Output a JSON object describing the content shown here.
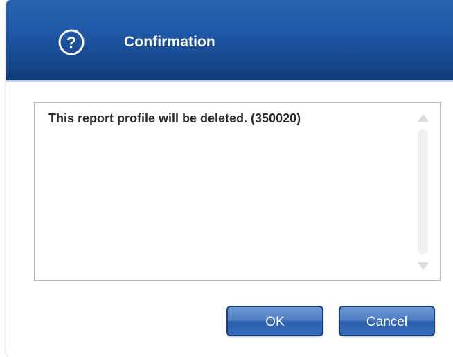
{
  "dialog": {
    "title": "Confirmation",
    "icon": "question-circle-icon",
    "message": "This report profile will be deleted. (350020)",
    "buttons": {
      "ok_label": "OK",
      "cancel_label": "Cancel"
    }
  },
  "colors": {
    "titlebar": "#1f58a6",
    "button": "#3a6fbe",
    "button_border": "#1c3e78",
    "message_text": "#2b2b2b"
  }
}
